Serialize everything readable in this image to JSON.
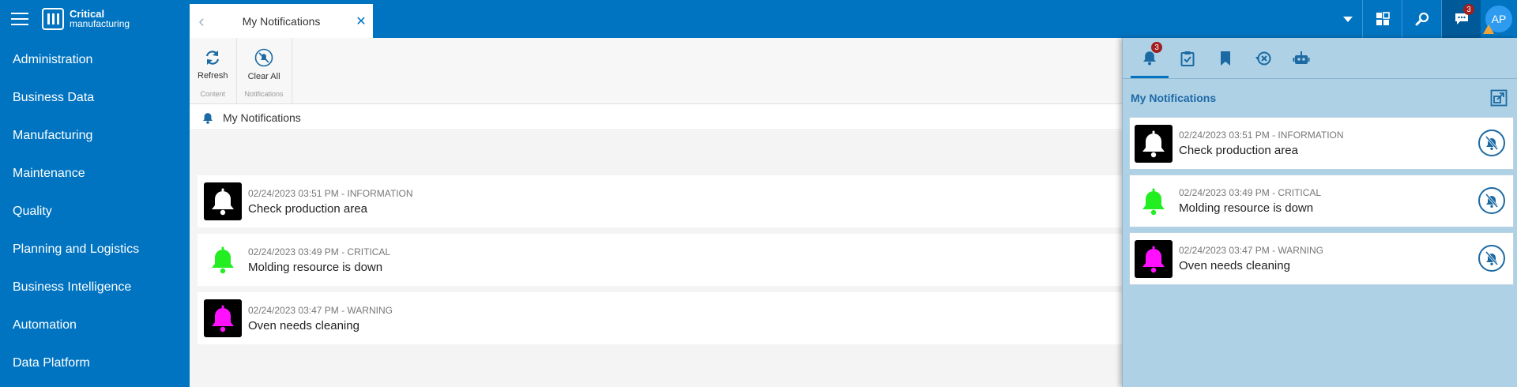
{
  "app": {
    "logo_line1": "Critical",
    "logo_line2": "manufacturing",
    "accent": "#0074c1"
  },
  "sidebar": {
    "items": [
      {
        "label": "Administration"
      },
      {
        "label": "Business Data"
      },
      {
        "label": "Manufacturing"
      },
      {
        "label": "Maintenance"
      },
      {
        "label": "Quality"
      },
      {
        "label": "Planning and Logistics"
      },
      {
        "label": "Business Intelligence"
      },
      {
        "label": "Automation"
      },
      {
        "label": "Data Platform"
      }
    ]
  },
  "tab": {
    "title": "My Notifications",
    "back_icon": "chevron-left-icon",
    "close_icon": "close-icon"
  },
  "topbar": {
    "messages_badge": "3",
    "avatar_initials": "AP"
  },
  "ribbon": {
    "refresh_label": "Refresh",
    "content_group": "Content",
    "clear_all_label": "Clear All",
    "notifications_group": "Notifications"
  },
  "breadcrumb": {
    "label": "My Notifications"
  },
  "notifications": [
    {
      "meta": "02/24/2023 03:51 PM - INFORMATION",
      "message": "Check production area",
      "bell_color": "#ffffff",
      "bg": "#000000"
    },
    {
      "meta": "02/24/2023 03:49 PM - CRITICAL",
      "message": "Molding resource is down",
      "bell_color": "#22ee22",
      "bg": "#ffffff"
    },
    {
      "meta": "02/24/2023 03:47 PM - WARNING",
      "message": "Oven needs cleaning",
      "bell_color": "#ff11ff",
      "bg": "#000000"
    }
  ],
  "panel": {
    "title": "My Notifications",
    "bell_badge": "3",
    "tabs": [
      "bell-icon",
      "checklist-icon",
      "bookmark-icon",
      "history-icon",
      "robot-icon"
    ]
  }
}
